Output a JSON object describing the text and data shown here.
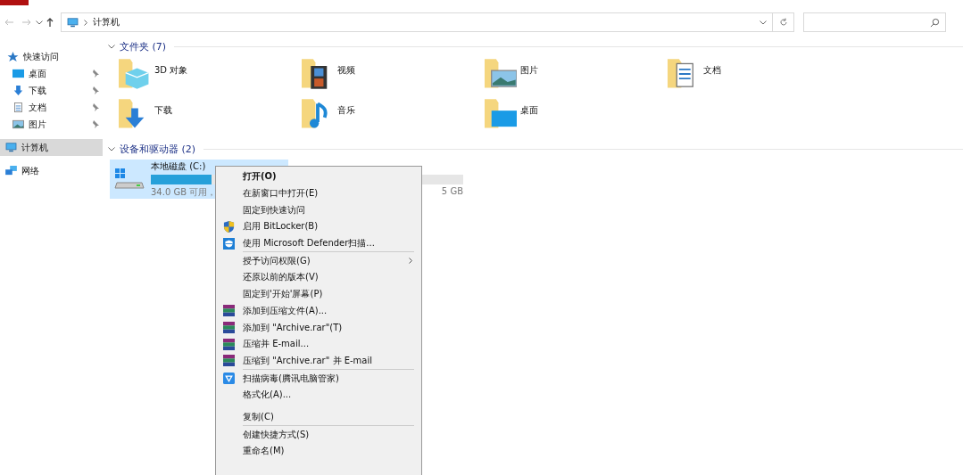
{
  "address_bar": {
    "path": [
      "计算机"
    ]
  },
  "sidebar": {
    "items": [
      {
        "kind": "section",
        "label": "快速访问",
        "selected": false,
        "pinned": false
      },
      {
        "kind": "child",
        "label": "桌面",
        "selected": false,
        "pinned": true
      },
      {
        "kind": "child",
        "label": "下载",
        "selected": false,
        "pinned": true
      },
      {
        "kind": "child",
        "label": "文档",
        "selected": false,
        "pinned": true
      },
      {
        "kind": "child",
        "label": "图片",
        "selected": false,
        "pinned": true
      },
      {
        "kind": "section",
        "label": "计算机",
        "selected": true,
        "pinned": false
      },
      {
        "kind": "section",
        "label": "网络",
        "selected": false,
        "pinned": false
      }
    ]
  },
  "folders": {
    "title": "文件夹 (7)",
    "items": [
      {
        "label": "3D 对象"
      },
      {
        "label": "视频"
      },
      {
        "label": "图片"
      },
      {
        "label": "文档"
      },
      {
        "label": "下载"
      },
      {
        "label": "音乐"
      },
      {
        "label": "桌面"
      }
    ]
  },
  "drives": {
    "title": "设备和驱动器 (2)",
    "items": [
      {
        "label": "本地磁盘 (C:)",
        "level": 0.45,
        "info": "34.0 GB 可用，",
        "selected": true
      },
      {
        "info": "5 GB",
        "selected": false
      }
    ]
  },
  "context_menu": {
    "items": [
      {
        "kind": "item",
        "label": "打开(O)",
        "bold": true
      },
      {
        "kind": "item",
        "label": "在新窗口中打开(E)",
        "bold": false
      },
      {
        "kind": "item",
        "label": "固定到快速访问",
        "bold": false
      },
      {
        "kind": "item",
        "label": "启用 BitLocker(B)",
        "bold": false
      },
      {
        "kind": "item",
        "label": "使用 Microsoft Defender扫描...",
        "bold": false
      },
      {
        "kind": "separator"
      },
      {
        "kind": "submenu",
        "label": "授予访问权限(G)",
        "bold": false
      },
      {
        "kind": "item",
        "label": "还原以前的版本(V)",
        "bold": false
      },
      {
        "kind": "item",
        "label": "固定到'开始'屏幕(P)",
        "bold": false
      },
      {
        "kind": "item",
        "label": "添加到压缩文件(A)...",
        "bold": false
      },
      {
        "kind": "item",
        "label": "添加到 \"Archive.rar\"(T)",
        "bold": false
      },
      {
        "kind": "item",
        "label": "压缩并 E-mail...",
        "bold": false
      },
      {
        "kind": "item",
        "label": "压缩到 \"Archive.rar\" 并 E-mail",
        "bold": false
      },
      {
        "kind": "separator"
      },
      {
        "kind": "item",
        "label": "扫描病毒(腾讯电脑管家)",
        "bold": false
      },
      {
        "kind": "item",
        "label": "格式化(A)...",
        "bold": false
      },
      {
        "kind": "gap"
      },
      {
        "kind": "item",
        "label": "复制(C)",
        "bold": false
      },
      {
        "kind": "separator"
      },
      {
        "kind": "item",
        "label": "创建快捷方式(S)",
        "bold": false
      },
      {
        "kind": "item",
        "label": "重命名(M)",
        "bold": false
      }
    ]
  }
}
